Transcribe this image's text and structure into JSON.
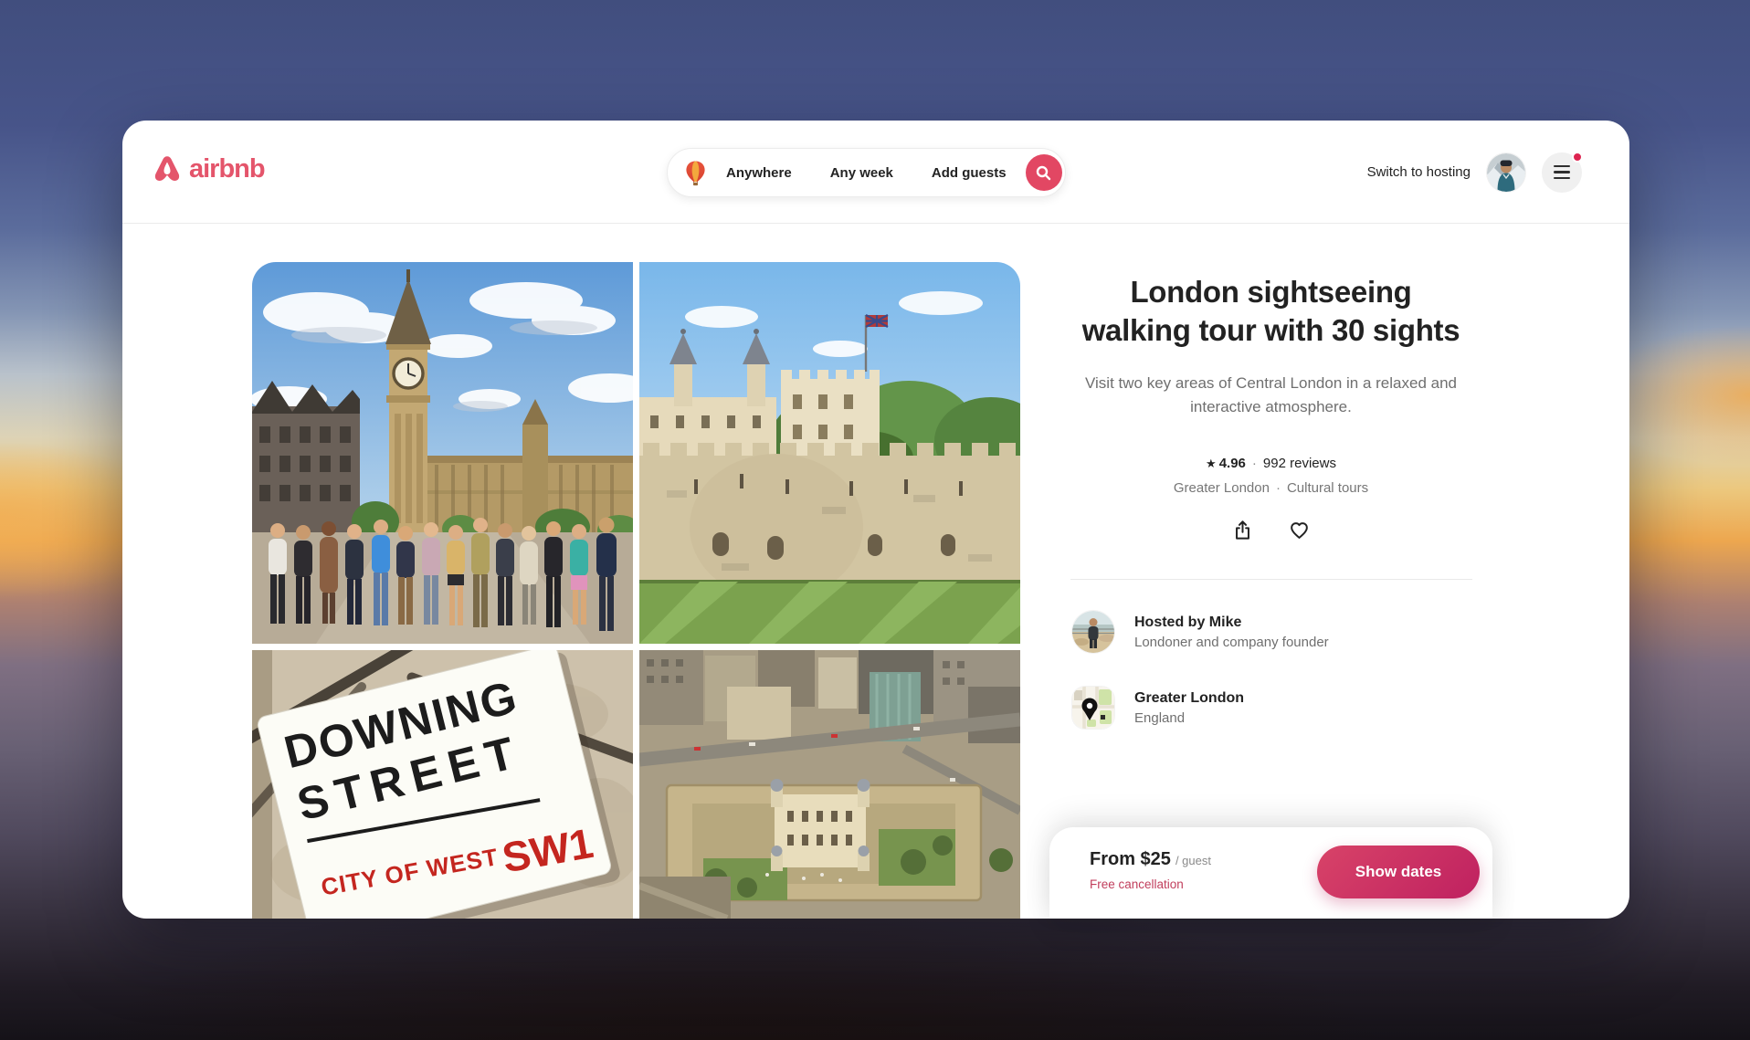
{
  "header": {
    "brand": "airbnb",
    "search": {
      "anywhere_label": "Anywhere",
      "any_week_label": "Any week",
      "add_guests_label": "Add guests"
    },
    "switch_to_hosting_label": "Switch to hosting"
  },
  "listing": {
    "title_lines": [
      "London sightseeing",
      "walking tour with 30 sights"
    ],
    "description": "Visit two key areas of Central London in a relaxed and interactive atmosphere.",
    "rating": {
      "star": "★",
      "value": "4.96",
      "separator": "·",
      "reviews": "992 reviews"
    },
    "meta": {
      "area": "Greater London",
      "separator": "·",
      "category": "Cultural tours"
    },
    "host": {
      "title": "Hosted by Mike",
      "subtitle": "Londoner and company founder"
    },
    "location": {
      "title": "Greater London",
      "subtitle": "England"
    }
  },
  "booking": {
    "price": "From $25",
    "price_unit": "/ guest",
    "cancellation_label": "Free cancellation",
    "cta_label": "Show dates"
  },
  "photos": {
    "downing_sign": {
      "line1": "DOWNING",
      "line2": "STREET",
      "line3": "CITY OF WEST",
      "code": "SW1"
    }
  },
  "colors": {
    "brand": "#e4556b",
    "search_button": "#e24763",
    "cta_gradient_start": "#d84368",
    "cta_gradient_end": "#bf2160",
    "notification_dot": "#dd2450",
    "cancellation_link": "#c13e5c"
  }
}
